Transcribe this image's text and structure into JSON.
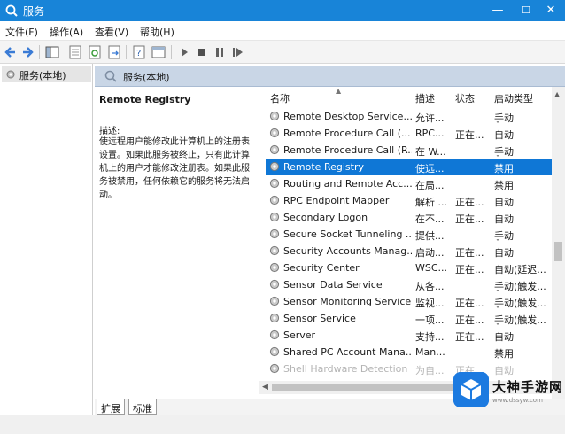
{
  "window": {
    "title": "服务",
    "controls": {
      "minimize": "—",
      "maximize": "☐",
      "close": "✕"
    }
  },
  "menu": [
    "文件(F)",
    "操作(A)",
    "查看(V)",
    "帮助(H)"
  ],
  "toolbar": {
    "icons": [
      "back-icon",
      "forward-icon",
      "show-tree-icon",
      "properties-icon",
      "refresh-icon",
      "export-icon",
      "help-icon",
      "console-icon",
      "start-icon",
      "stop-icon",
      "pause-icon",
      "restart-icon"
    ]
  },
  "tree": {
    "item": "服务(本地)"
  },
  "header": {
    "label": "服务(本地)"
  },
  "description": {
    "title": "Remote Registry",
    "label": "描述:",
    "body": "使远程用户能修改此计算机上的注册表设置。如果此服务被终止，只有此计算机上的用户才能修改注册表。如果此服务被禁用，任何依赖它的服务将无法启动。"
  },
  "columns": {
    "name": "名称",
    "desc": "描述",
    "status": "状态",
    "start": "启动类型"
  },
  "services": [
    {
      "name": "Remote Desktop Service...",
      "desc": "允许...",
      "status": "",
      "start": "手动"
    },
    {
      "name": "Remote Procedure Call (...",
      "desc": "RPC...",
      "status": "正在...",
      "start": "自动"
    },
    {
      "name": "Remote Procedure Call (R...",
      "desc": "在 W...",
      "status": "",
      "start": "手动"
    },
    {
      "name": "Remote Registry",
      "desc": "使远...",
      "status": "",
      "start": "禁用",
      "selected": true
    },
    {
      "name": "Routing and Remote Acc...",
      "desc": "在局...",
      "status": "",
      "start": "禁用"
    },
    {
      "name": "RPC Endpoint Mapper",
      "desc": "解析 ...",
      "status": "正在...",
      "start": "自动"
    },
    {
      "name": "Secondary Logon",
      "desc": "在不...",
      "status": "正在...",
      "start": "自动"
    },
    {
      "name": "Secure Socket Tunneling ...",
      "desc": "提供...",
      "status": "",
      "start": "手动"
    },
    {
      "name": "Security Accounts Manag...",
      "desc": "启动...",
      "status": "正在...",
      "start": "自动"
    },
    {
      "name": "Security Center",
      "desc": "WSC...",
      "status": "正在...",
      "start": "自动(延迟..."
    },
    {
      "name": "Sensor Data Service",
      "desc": "从各...",
      "status": "",
      "start": "手动(触发..."
    },
    {
      "name": "Sensor Monitoring Service",
      "desc": "监视...",
      "status": "正在...",
      "start": "手动(触发..."
    },
    {
      "name": "Sensor Service",
      "desc": "一项...",
      "status": "正在...",
      "start": "手动(触发..."
    },
    {
      "name": "Server",
      "desc": "支持...",
      "status": "正在...",
      "start": "自动"
    },
    {
      "name": "Shared PC Account Mana...",
      "desc": "Man...",
      "status": "",
      "start": "禁用"
    },
    {
      "name": "Shell Hardware Detection",
      "desc": "为自...",
      "status": "正在...",
      "start": "自动",
      "faded": true
    }
  ],
  "tabs": [
    "扩展",
    "标准"
  ],
  "watermark": {
    "text": "大神手游网",
    "sub": "www.dssyw.com"
  },
  "colors": {
    "titlebar": "#1884d8",
    "selection": "#0f77d6",
    "header_band": "#c9d6e6"
  }
}
